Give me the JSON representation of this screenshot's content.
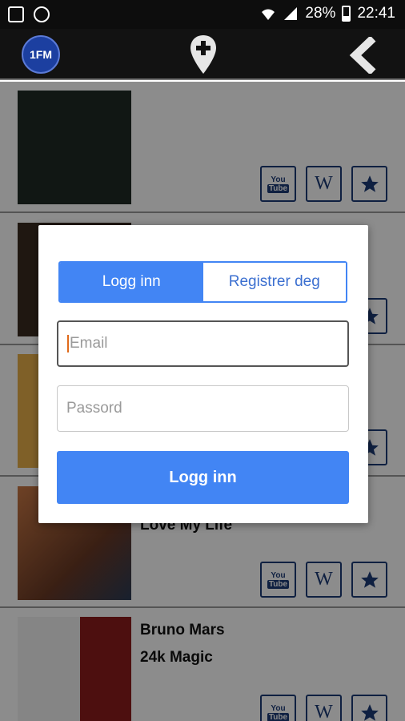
{
  "status_bar": {
    "battery": "28%",
    "time": "22:41",
    "icons": [
      "image-icon",
      "sync-icon",
      "wifi-icon",
      "signal-icon",
      "battery-icon"
    ]
  },
  "header": {
    "logo_text": "1FM",
    "icons": [
      "logo",
      "add-location-icon",
      "back-chevron-icon"
    ]
  },
  "tracks": [
    {
      "artist": "",
      "title": "",
      "art_color": "#1f2a25"
    },
    {
      "artist": "",
      "title": "",
      "art_color": "#3a2a20"
    },
    {
      "artist": "",
      "title": "",
      "art_color": "#e8b04a"
    },
    {
      "artist": "",
      "title": "Love My Life",
      "art_color": "#c97845"
    },
    {
      "artist": "Bruno Mars",
      "title": "24k Magic",
      "art_color": "#d9d9d9"
    }
  ],
  "actions": {
    "youtube": {
      "line1": "You",
      "line2": "Tube"
    },
    "wiki": "W"
  },
  "modal": {
    "tab_login": "Logg inn",
    "tab_register": "Registrer deg",
    "email_placeholder": "Email",
    "password_placeholder": "Passord",
    "submit_label": "Logg inn"
  },
  "colors": {
    "accent": "#4285f4",
    "icon_border": "#1d3b77",
    "status_bar": "#0d0d0d"
  }
}
